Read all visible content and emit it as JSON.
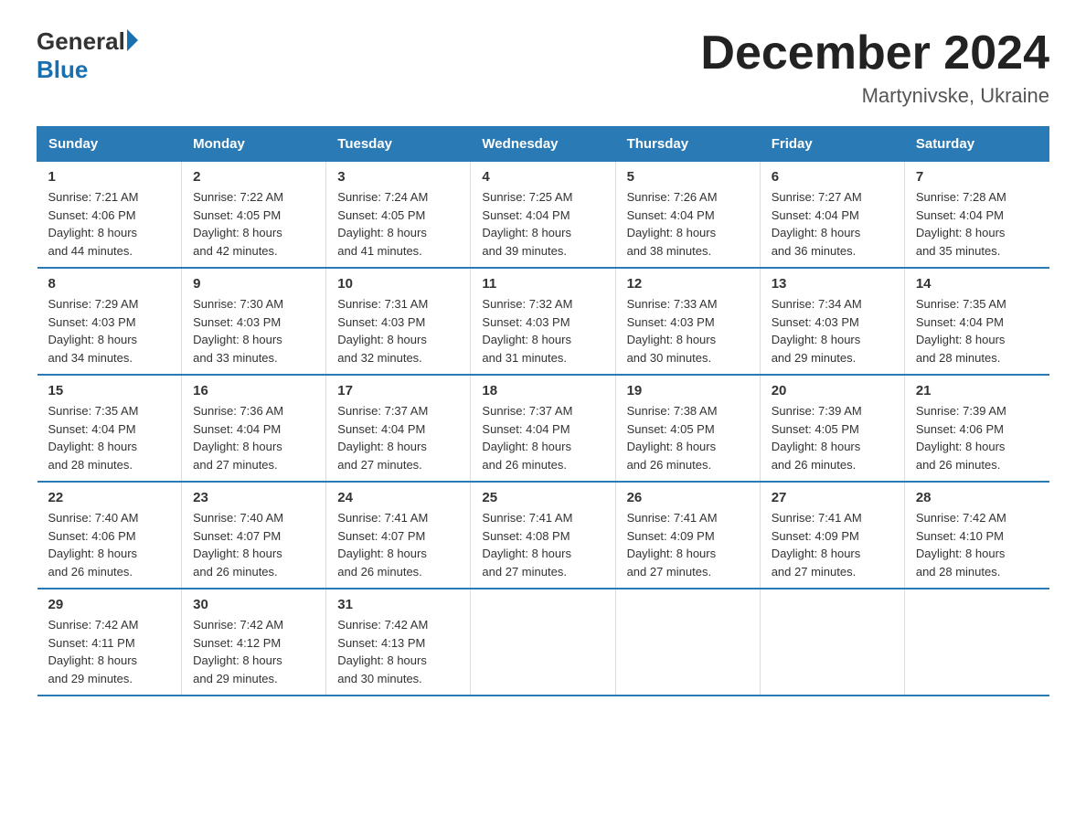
{
  "header": {
    "logo_general": "General",
    "logo_blue": "Blue",
    "main_title": "December 2024",
    "subtitle": "Martynivske, Ukraine"
  },
  "days_of_week": [
    "Sunday",
    "Monday",
    "Tuesday",
    "Wednesday",
    "Thursday",
    "Friday",
    "Saturday"
  ],
  "weeks": [
    [
      {
        "day": "1",
        "sunrise": "7:21 AM",
        "sunset": "4:06 PM",
        "daylight": "8 hours and 44 minutes."
      },
      {
        "day": "2",
        "sunrise": "7:22 AM",
        "sunset": "4:05 PM",
        "daylight": "8 hours and 42 minutes."
      },
      {
        "day": "3",
        "sunrise": "7:24 AM",
        "sunset": "4:05 PM",
        "daylight": "8 hours and 41 minutes."
      },
      {
        "day": "4",
        "sunrise": "7:25 AM",
        "sunset": "4:04 PM",
        "daylight": "8 hours and 39 minutes."
      },
      {
        "day": "5",
        "sunrise": "7:26 AM",
        "sunset": "4:04 PM",
        "daylight": "8 hours and 38 minutes."
      },
      {
        "day": "6",
        "sunrise": "7:27 AM",
        "sunset": "4:04 PM",
        "daylight": "8 hours and 36 minutes."
      },
      {
        "day": "7",
        "sunrise": "7:28 AM",
        "sunset": "4:04 PM",
        "daylight": "8 hours and 35 minutes."
      }
    ],
    [
      {
        "day": "8",
        "sunrise": "7:29 AM",
        "sunset": "4:03 PM",
        "daylight": "8 hours and 34 minutes."
      },
      {
        "day": "9",
        "sunrise": "7:30 AM",
        "sunset": "4:03 PM",
        "daylight": "8 hours and 33 minutes."
      },
      {
        "day": "10",
        "sunrise": "7:31 AM",
        "sunset": "4:03 PM",
        "daylight": "8 hours and 32 minutes."
      },
      {
        "day": "11",
        "sunrise": "7:32 AM",
        "sunset": "4:03 PM",
        "daylight": "8 hours and 31 minutes."
      },
      {
        "day": "12",
        "sunrise": "7:33 AM",
        "sunset": "4:03 PM",
        "daylight": "8 hours and 30 minutes."
      },
      {
        "day": "13",
        "sunrise": "7:34 AM",
        "sunset": "4:03 PM",
        "daylight": "8 hours and 29 minutes."
      },
      {
        "day": "14",
        "sunrise": "7:35 AM",
        "sunset": "4:04 PM",
        "daylight": "8 hours and 28 minutes."
      }
    ],
    [
      {
        "day": "15",
        "sunrise": "7:35 AM",
        "sunset": "4:04 PM",
        "daylight": "8 hours and 28 minutes."
      },
      {
        "day": "16",
        "sunrise": "7:36 AM",
        "sunset": "4:04 PM",
        "daylight": "8 hours and 27 minutes."
      },
      {
        "day": "17",
        "sunrise": "7:37 AM",
        "sunset": "4:04 PM",
        "daylight": "8 hours and 27 minutes."
      },
      {
        "day": "18",
        "sunrise": "7:37 AM",
        "sunset": "4:04 PM",
        "daylight": "8 hours and 26 minutes."
      },
      {
        "day": "19",
        "sunrise": "7:38 AM",
        "sunset": "4:05 PM",
        "daylight": "8 hours and 26 minutes."
      },
      {
        "day": "20",
        "sunrise": "7:39 AM",
        "sunset": "4:05 PM",
        "daylight": "8 hours and 26 minutes."
      },
      {
        "day": "21",
        "sunrise": "7:39 AM",
        "sunset": "4:06 PM",
        "daylight": "8 hours and 26 minutes."
      }
    ],
    [
      {
        "day": "22",
        "sunrise": "7:40 AM",
        "sunset": "4:06 PM",
        "daylight": "8 hours and 26 minutes."
      },
      {
        "day": "23",
        "sunrise": "7:40 AM",
        "sunset": "4:07 PM",
        "daylight": "8 hours and 26 minutes."
      },
      {
        "day": "24",
        "sunrise": "7:41 AM",
        "sunset": "4:07 PM",
        "daylight": "8 hours and 26 minutes."
      },
      {
        "day": "25",
        "sunrise": "7:41 AM",
        "sunset": "4:08 PM",
        "daylight": "8 hours and 27 minutes."
      },
      {
        "day": "26",
        "sunrise": "7:41 AM",
        "sunset": "4:09 PM",
        "daylight": "8 hours and 27 minutes."
      },
      {
        "day": "27",
        "sunrise": "7:41 AM",
        "sunset": "4:09 PM",
        "daylight": "8 hours and 27 minutes."
      },
      {
        "day": "28",
        "sunrise": "7:42 AM",
        "sunset": "4:10 PM",
        "daylight": "8 hours and 28 minutes."
      }
    ],
    [
      {
        "day": "29",
        "sunrise": "7:42 AM",
        "sunset": "4:11 PM",
        "daylight": "8 hours and 29 minutes."
      },
      {
        "day": "30",
        "sunrise": "7:42 AM",
        "sunset": "4:12 PM",
        "daylight": "8 hours and 29 minutes."
      },
      {
        "day": "31",
        "sunrise": "7:42 AM",
        "sunset": "4:13 PM",
        "daylight": "8 hours and 30 minutes."
      },
      null,
      null,
      null,
      null
    ]
  ],
  "labels": {
    "sunrise": "Sunrise:",
    "sunset": "Sunset:",
    "daylight": "Daylight:"
  }
}
